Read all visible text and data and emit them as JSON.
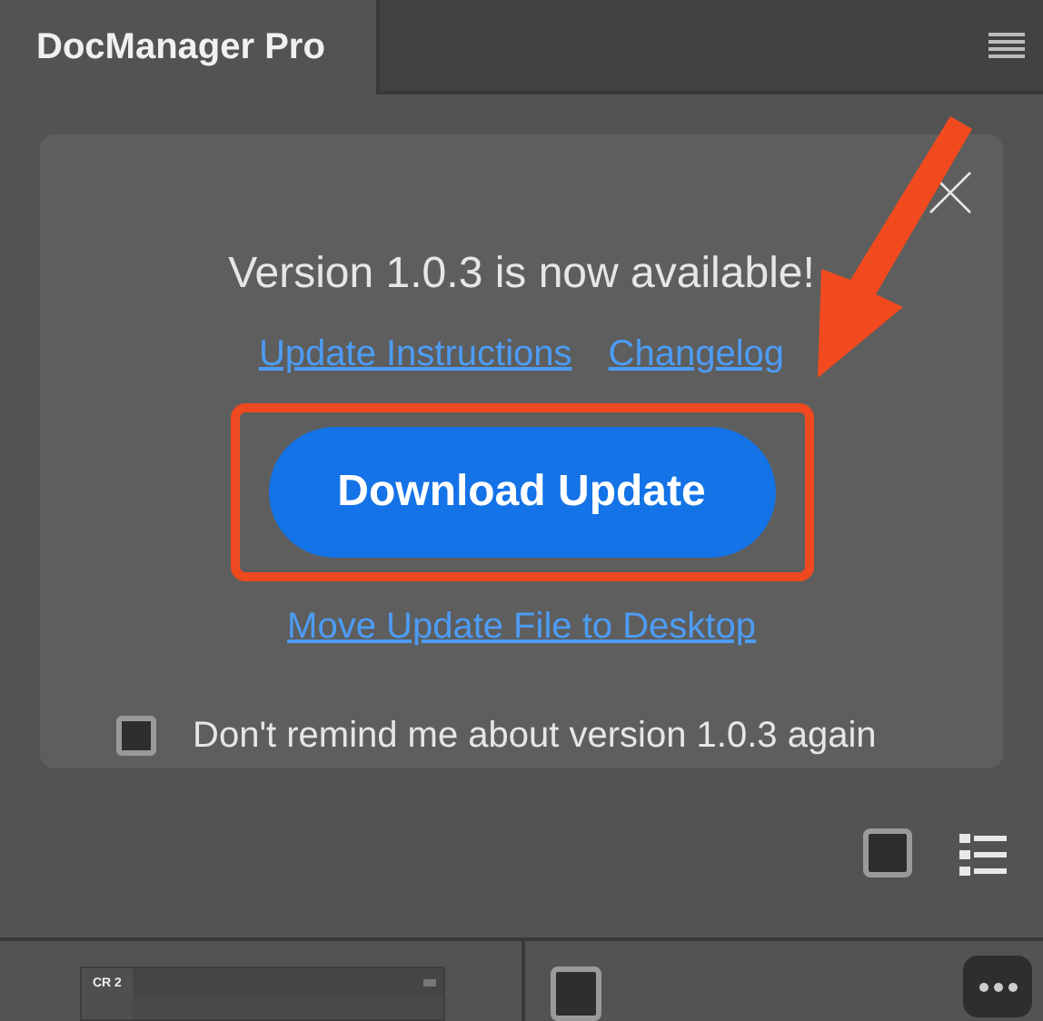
{
  "panel": {
    "title": "DocManager Pro"
  },
  "update_notice": {
    "message": "Version 1.0.3 is now available!",
    "links": [
      "Update Instructions",
      "Changelog"
    ],
    "button": "Download Update",
    "secondary_link": "Move Update File to Desktop",
    "checkbox": {
      "label": "Don't remind me about version 1.0.3 again",
      "checked": false
    }
  },
  "thumbnail": {
    "label": "CR 2"
  }
}
